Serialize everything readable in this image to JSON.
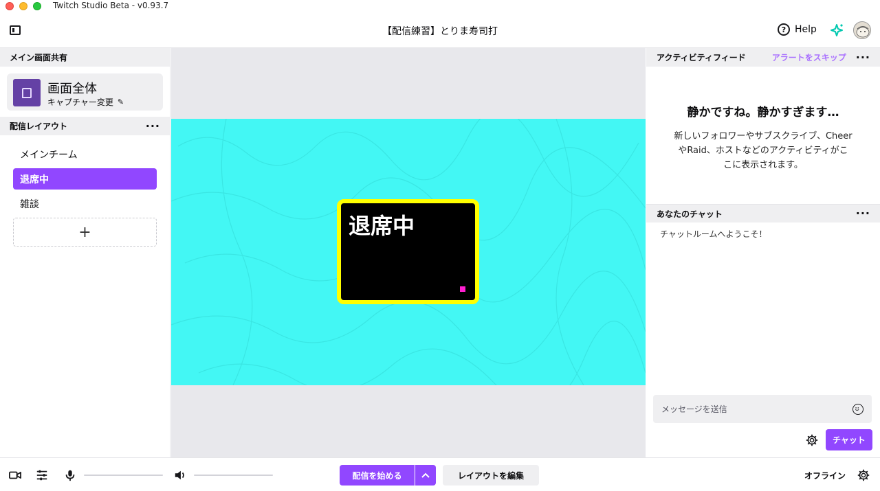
{
  "window": {
    "title": "Twitch Studio Beta - v0.93.7"
  },
  "header": {
    "stream_title": "【配信練習】とりま寿司打",
    "help_label": "Help"
  },
  "left_panel": {
    "main_share": {
      "heading": "メイン画面共有",
      "source_title": "画面全体",
      "change_capture": "キャプチャー変更"
    },
    "layouts": {
      "heading": "配信レイアウト",
      "items": [
        {
          "label": "メインチーム",
          "active": false
        },
        {
          "label": "退席中",
          "active": true
        },
        {
          "label": "雑談",
          "active": false
        }
      ],
      "add_label": "+"
    }
  },
  "preview": {
    "brb_text": "退席中"
  },
  "right_panel": {
    "activity_feed": {
      "heading": "アクティビティフィード",
      "skip_alerts": "アラートをスキップ",
      "empty_title": "静かですね。静かすぎます…",
      "empty_body": "新しいフォロワーやサブスクライブ、CheerやRaid、ホストなどのアクティビティがここに表示されます。"
    },
    "chat": {
      "heading": "あなたのチャット",
      "welcome": "チャットルームへようこそ！",
      "placeholder": "メッセージを送信",
      "send_label": "チャット"
    }
  },
  "bottom_bar": {
    "go_live": "配信を始める",
    "edit_layout": "レイアウトを編集",
    "status": "オフライン"
  },
  "colors": {
    "accent": "#9147ff",
    "preview_bg": "#43f7f4",
    "brb_border": "#ffff00",
    "link": "#a970ff"
  }
}
